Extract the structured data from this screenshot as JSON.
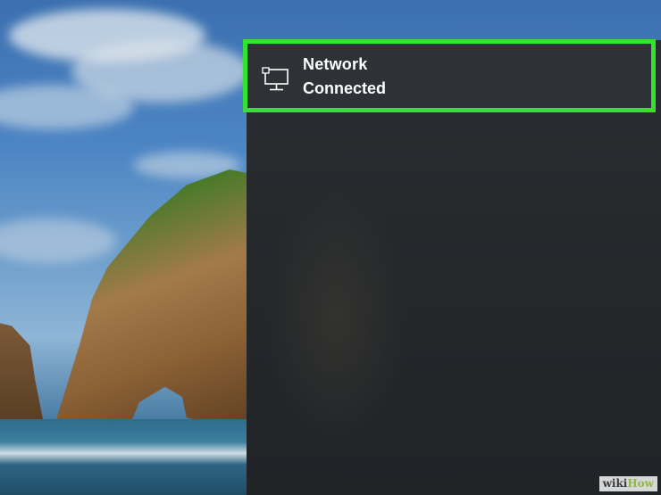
{
  "network_tile": {
    "title": "Network",
    "status": "Connected",
    "icon": "network-monitor-icon",
    "highlight_color": "#2fe52f"
  },
  "watermark": {
    "part_a": "wiki",
    "part_b": "How"
  },
  "colors": {
    "panel": "#25292c",
    "tile_text": "#ffffff"
  }
}
